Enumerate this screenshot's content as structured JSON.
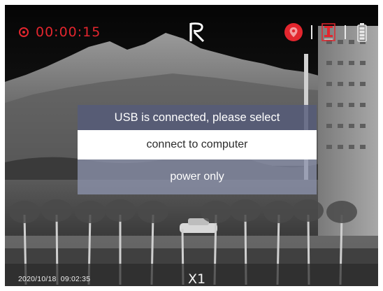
{
  "status_bar": {
    "recording_time": "00:00:15",
    "rec_icon": "record-dot-icon",
    "logo_icon": "brand-logo-icon",
    "location_icon": "location-pin-icon",
    "sensor_icon": "thermal-sensor-icon",
    "battery_icon": "battery-icon"
  },
  "dialog": {
    "title": "USB is connected, please select",
    "options": [
      {
        "label": "connect to computer"
      },
      {
        "label": "power only"
      }
    ]
  },
  "footer": {
    "datetime": "2020/10/18  09:02:35",
    "zoom": "X1"
  },
  "colors": {
    "accent": "#e3262e",
    "dialog_title_bg": "#565c7a",
    "dialog_selected_bg": "#ffffff",
    "dialog_option_bg": "#8c92ac"
  }
}
